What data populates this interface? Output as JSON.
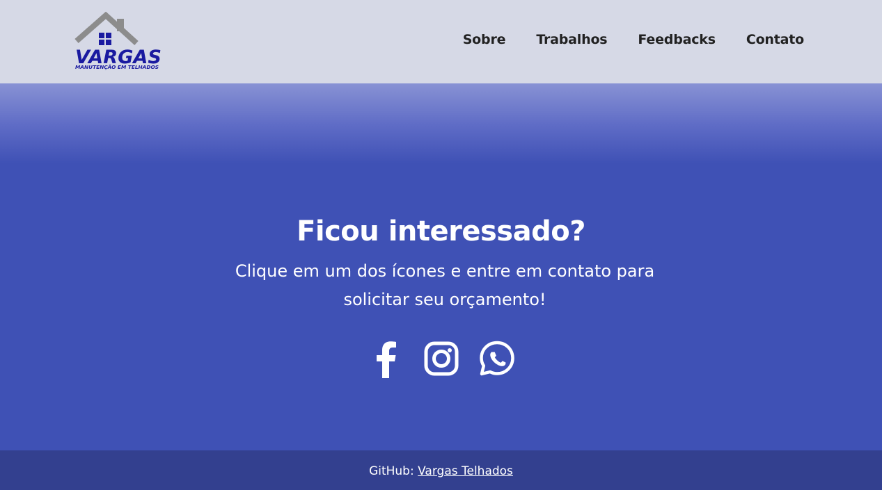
{
  "brand": {
    "logo_text": "VARGAS",
    "logo_tagline": "MANUTENÇÃO EM TELHADOS",
    "logo_colors": {
      "roof": "#8c8c8c",
      "text": "#1a1aa0"
    }
  },
  "nav": {
    "items": [
      {
        "label": "Sobre"
      },
      {
        "label": "Trabalhos"
      },
      {
        "label": "Feedbacks"
      },
      {
        "label": "Contato"
      }
    ]
  },
  "cta": {
    "title": "Ficou interessado?",
    "subtitle": "Clique em um dos ícones e entre em contato para solicitar seu orçamento!"
  },
  "social": [
    {
      "icon": "facebook-icon"
    },
    {
      "icon": "instagram-icon"
    },
    {
      "icon": "whatsapp-icon"
    }
  ],
  "footer": {
    "prefix": "GitHub: ",
    "link_label": "Vargas Telhados"
  },
  "colors": {
    "header_bg": "#d6d9e6",
    "main_bg": "#3f51b5",
    "footer_bg": "#33408f",
    "text_light": "#ffffff",
    "nav_text": "#212121"
  }
}
